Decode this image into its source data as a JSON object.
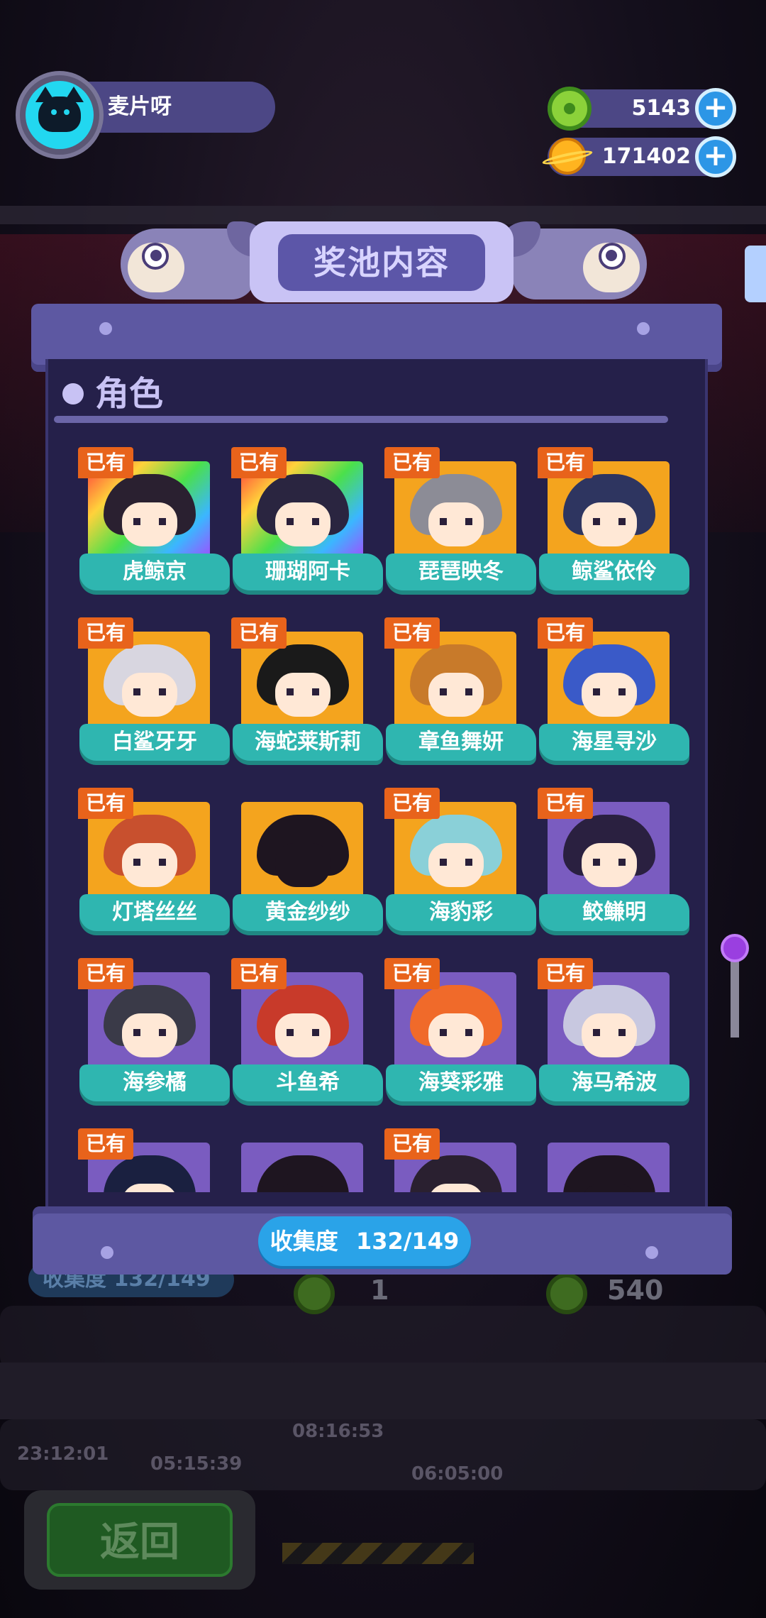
{
  "player": {
    "name": "麦片呀"
  },
  "resources": [
    {
      "icon": "donut-coin-icon",
      "value": "5143"
    },
    {
      "icon": "planet-coin-icon",
      "value": "171402"
    }
  ],
  "title": "奖池内容",
  "section": {
    "title": "角色"
  },
  "badge_label": "已有",
  "characters": [
    {
      "name": "虎鲸京",
      "owned": true,
      "frame": "rainbow",
      "hair": "#2a2030"
    },
    {
      "name": "珊瑚阿卡",
      "owned": true,
      "frame": "rainbow",
      "hair": "#2a2540"
    },
    {
      "name": "琵琶映冬",
      "owned": true,
      "frame": "gold",
      "hair": "#8c8c96"
    },
    {
      "name": "鲸鲨依伶",
      "owned": true,
      "frame": "gold",
      "hair": "#2e3560"
    },
    {
      "name": "白鲨牙牙",
      "owned": true,
      "frame": "gold",
      "hair": "#d8d6e0"
    },
    {
      "name": "海蛇莱斯莉",
      "owned": true,
      "frame": "gold",
      "hair": "#1a1a1a"
    },
    {
      "name": "章鱼舞妍",
      "owned": true,
      "frame": "gold",
      "hair": "#c87a2a"
    },
    {
      "name": "海星寻沙",
      "owned": true,
      "frame": "gold",
      "hair": "#3a5ac8"
    },
    {
      "name": "灯塔丝丝",
      "owned": true,
      "frame": "gold",
      "hair": "#c8502e"
    },
    {
      "name": "黄金纱纱",
      "owned": false,
      "frame": "gold",
      "hair": "#1e1520"
    },
    {
      "name": "海豹彩",
      "owned": true,
      "frame": "gold",
      "hair": "#8ad0d8"
    },
    {
      "name": "鲛鳒明",
      "owned": true,
      "frame": "purple",
      "hair": "#2a2040"
    },
    {
      "name": "海参橘",
      "owned": true,
      "frame": "purple",
      "hair": "#3a3a48"
    },
    {
      "name": "斗鱼希",
      "owned": true,
      "frame": "purple",
      "hair": "#c83a2a"
    },
    {
      "name": "海葵彩雅",
      "owned": true,
      "frame": "purple",
      "hair": "#f06a2a"
    },
    {
      "name": "海马希波",
      "owned": true,
      "frame": "purple",
      "hair": "#c8c8e0"
    },
    {
      "name": "",
      "owned": true,
      "frame": "purple",
      "hair": "#1a2040"
    },
    {
      "name": "",
      "owned": false,
      "frame": "purple",
      "hair": "#1e1520"
    },
    {
      "name": "",
      "owned": true,
      "frame": "purple",
      "hair": "#2a2030"
    },
    {
      "name": "",
      "owned": false,
      "frame": "purple",
      "hair": "#1e1520"
    }
  ],
  "progress": {
    "label": "收集度",
    "value": "132/149"
  },
  "background": {
    "dim_progress": "收集度 132/149",
    "dim_count_left": "1",
    "dim_count_right": "540",
    "timers": [
      "23:12:01",
      "05:15:39",
      "08:16:53",
      "06:05:00"
    ]
  },
  "back_button": {
    "label": "返回"
  },
  "colors": {
    "accent": "#5d58a2",
    "panel": "#25204a",
    "tag": "#2fb6b0",
    "badge": "#e8631b",
    "progress": "#2aa3e8"
  }
}
